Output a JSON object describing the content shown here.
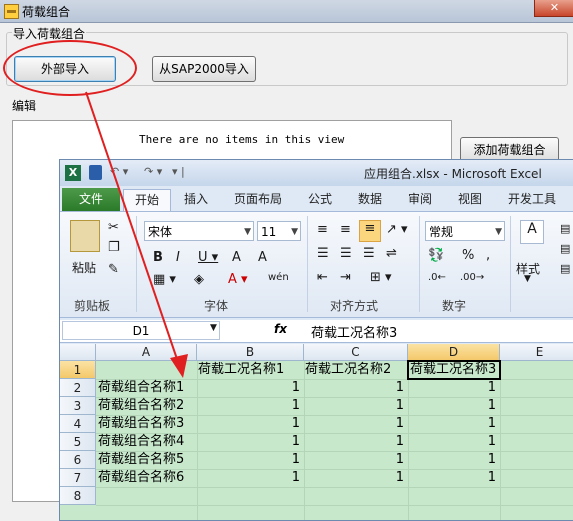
{
  "dialog": {
    "title": "荷载组合",
    "close": "✕",
    "import_group_label": "导入荷载组合",
    "btn_external": "外部导入",
    "btn_sap": "从SAP2000导入",
    "edit_group_label": "编辑",
    "empty_message": "There are no items in this view",
    "btn_add": "添加荷载组合",
    "annotation_color": "#e02020"
  },
  "excel": {
    "logo": "X",
    "title": "应用组合.xlsx - Microsoft Excel",
    "tabs": [
      "文件",
      "开始",
      "插入",
      "页面布局",
      "公式",
      "数据",
      "审阅",
      "视图",
      "开发工具"
    ],
    "ribbon": {
      "paste": "粘贴",
      "clipboard": "剪贴板",
      "font_name": "宋体",
      "font_size": "11",
      "font": "字体",
      "alignment": "对齐方式",
      "number_format": "常规",
      "number": "数字",
      "styles": "样式",
      "wen": "wén"
    },
    "name_box": "D1",
    "fx": "fx",
    "formula": "荷载工况名称3",
    "columns": [
      "A",
      "B",
      "C",
      "D",
      "E"
    ],
    "rows": [
      "1",
      "2",
      "3",
      "4",
      "5",
      "6",
      "7",
      "8"
    ],
    "header_row": [
      "",
      "荷载工况名称1",
      "荷载工况名称2",
      "荷载工况名称3"
    ],
    "data_rows": [
      [
        "荷载组合名称1",
        "1",
        "1",
        "1"
      ],
      [
        "荷载组合名称2",
        "1",
        "1",
        "1"
      ],
      [
        "荷载组合名称3",
        "1",
        "1",
        "1"
      ],
      [
        "荷载组合名称4",
        "1",
        "1",
        "1"
      ],
      [
        "荷载组合名称5",
        "1",
        "1",
        "1"
      ],
      [
        "荷载组合名称6",
        "1",
        "1",
        "1"
      ]
    ],
    "selected_cell": "D1"
  }
}
